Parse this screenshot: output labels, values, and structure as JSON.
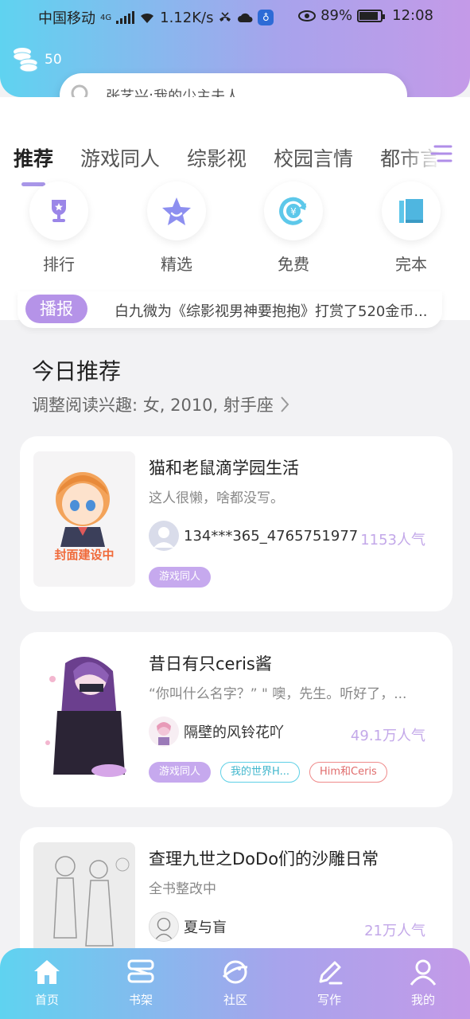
{
  "status_bar": {
    "carrier": "中国移动",
    "network": "4G",
    "speed": "1.12K/s",
    "battery": "89%",
    "battery_level": 0.89,
    "time": "12:08"
  },
  "header": {
    "coins": "50",
    "search_placeholder": "张艺兴:我的少主夫人"
  },
  "tabs": [
    {
      "label": "推荐",
      "active": true
    },
    {
      "label": "游戏同人",
      "active": false
    },
    {
      "label": "综影视",
      "active": false
    },
    {
      "label": "校园言情",
      "active": false
    },
    {
      "label": "都市言情",
      "active": false
    }
  ],
  "quick_nav": [
    {
      "label": "排行",
      "icon": "trophy-icon",
      "color": "#9b86e8"
    },
    {
      "label": "精选",
      "icon": "star-icon",
      "color": "#8d8ff0"
    },
    {
      "label": "免费",
      "icon": "yen-refresh-icon",
      "color": "#5dc8ea"
    },
    {
      "label": "完本",
      "icon": "book-icon",
      "color": "#5ec6ea"
    }
  ],
  "broadcast": {
    "tag": "播报",
    "text": "白九微为《综影视男神要抱抱》打赏了520金币..."
  },
  "recommend": {
    "title": "今日推荐",
    "subtitle": "调整阅读兴趣: 女, 2010, 射手座"
  },
  "books": [
    {
      "title": "猫和老鼠滴学园生活",
      "desc": "这人很懒，啥都没写。",
      "author": "134***365_4765751977",
      "popularity": "1153人气",
      "cover_text": "封面建设中",
      "tags": [
        "游戏同人"
      ]
    },
    {
      "title": "昔日有只ceris酱",
      "desc": "“你叫什么名字？” \" 噢，先生。听好了，...",
      "author": "隔壁的风铃花吖",
      "popularity": "49.1万人气",
      "tags": [
        "游戏同人",
        "我的世界H...",
        "Him和Ceris"
      ]
    },
    {
      "title": "查理九世之DoDo们的沙雕日常",
      "desc": "全书整改中",
      "author": "夏与盲",
      "popularity": "21万人气",
      "tags": []
    }
  ],
  "bottom_nav": [
    {
      "label": "首页",
      "icon": "home-icon"
    },
    {
      "label": "书架",
      "icon": "bookshelf-icon"
    },
    {
      "label": "社区",
      "icon": "planet-icon"
    },
    {
      "label": "写作",
      "icon": "pen-icon"
    },
    {
      "label": "我的",
      "icon": "user-icon"
    }
  ]
}
